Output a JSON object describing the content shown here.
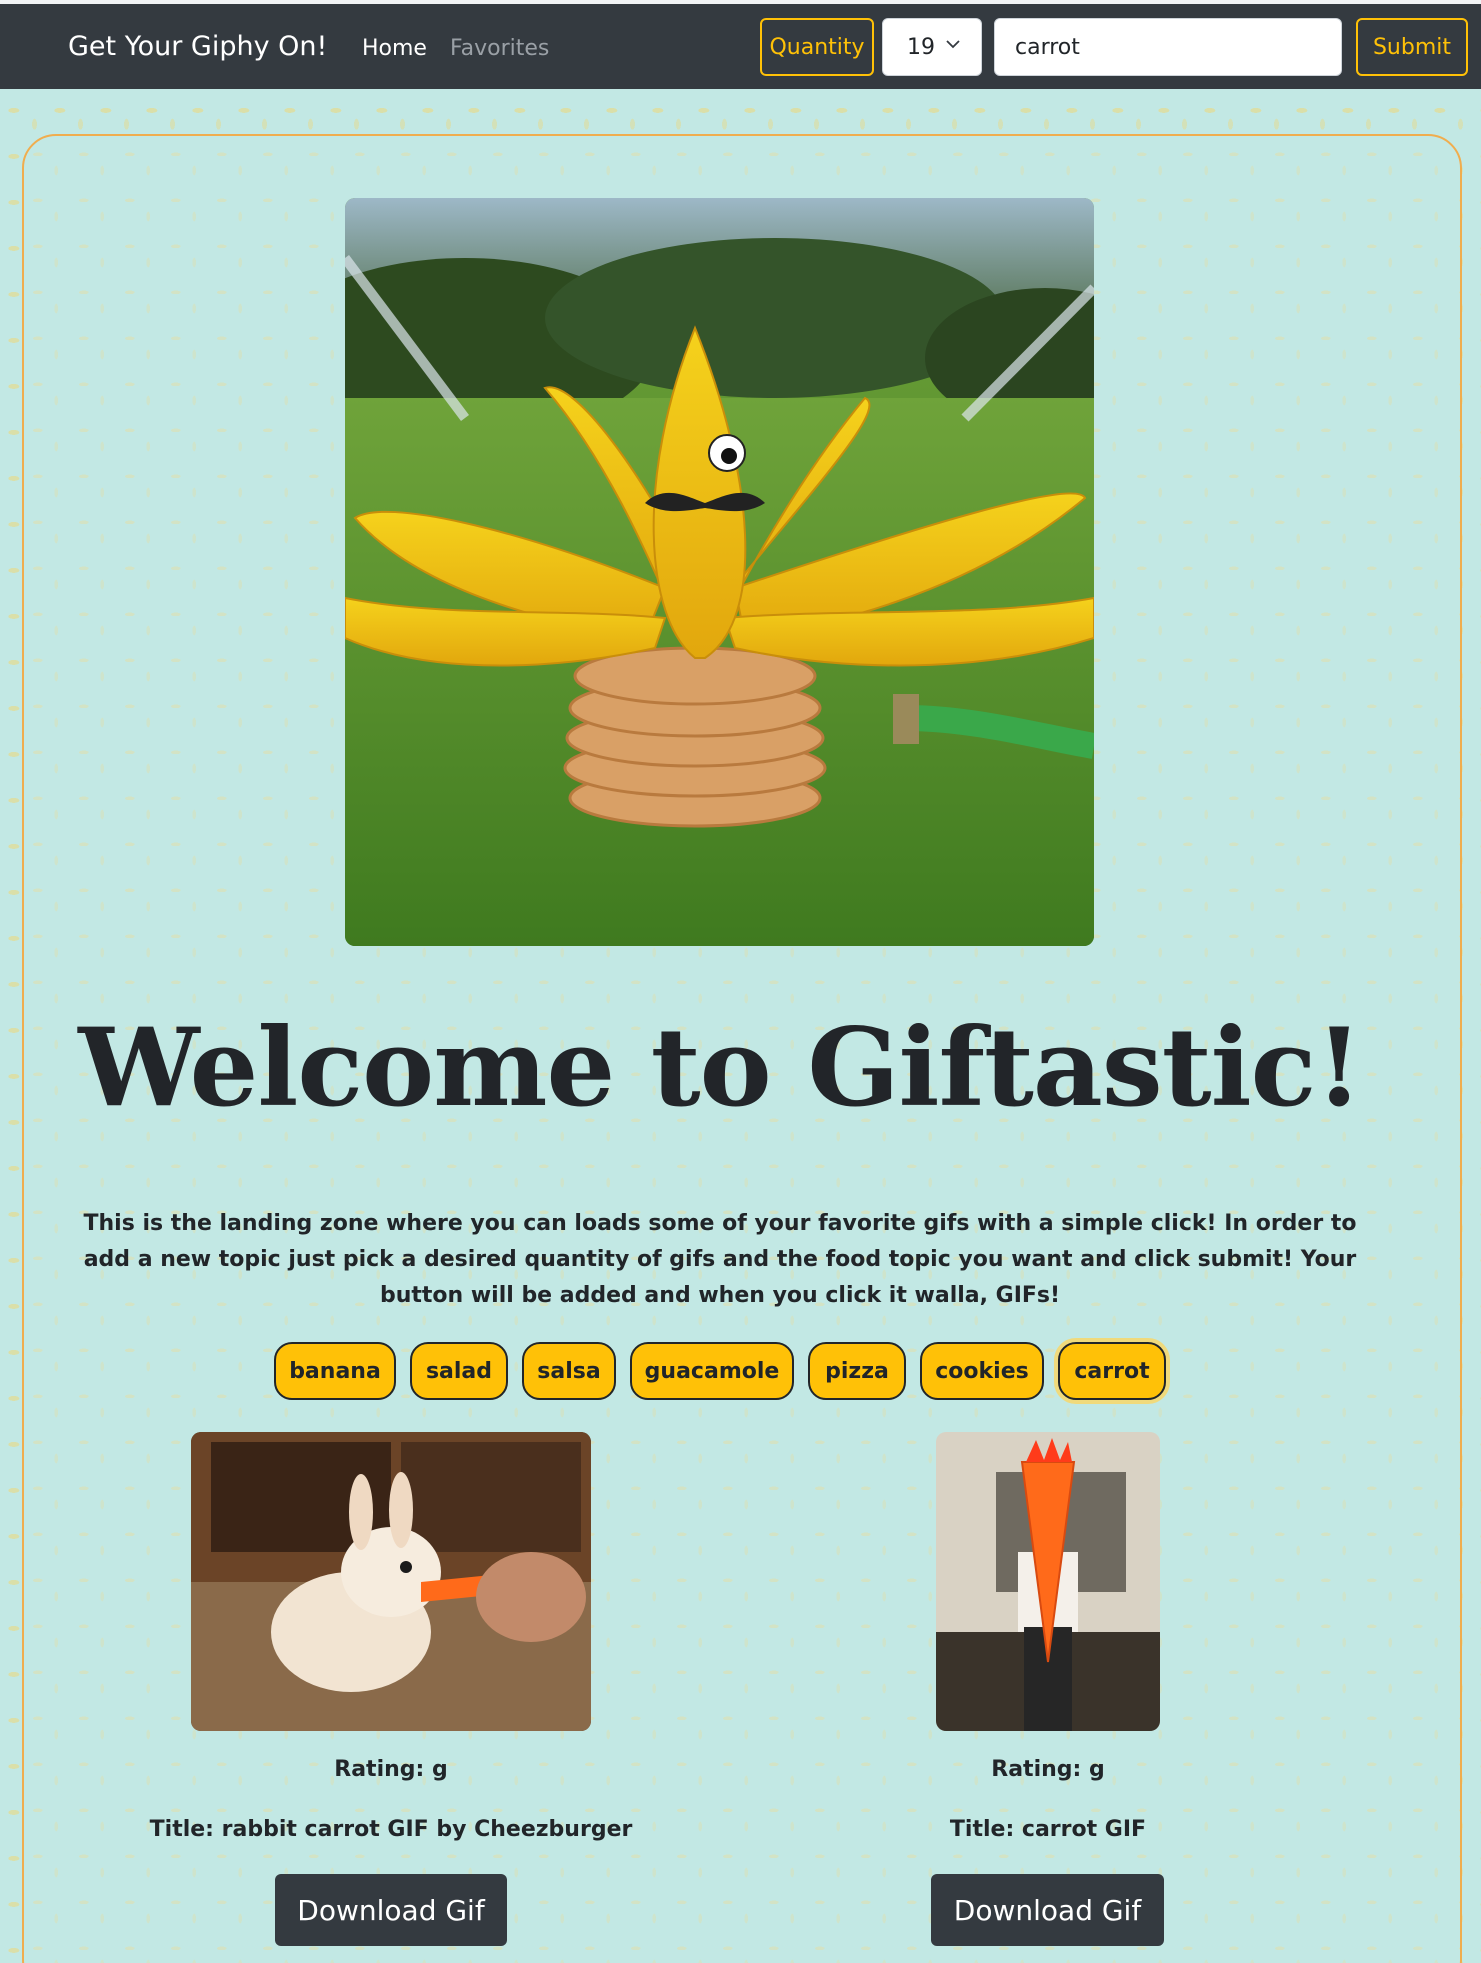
{
  "navbar": {
    "brand": "Get Your Giphy On!",
    "links": [
      {
        "label": "Home",
        "active": true
      },
      {
        "label": "Favorites",
        "active": false
      }
    ],
    "quantity_label": "Quantity",
    "quantity_value": "19",
    "search_value": "carrot",
    "submit_label": "Submit"
  },
  "hero": {
    "image": "banana-sprinkler-image"
  },
  "main": {
    "headline": "Welcome to Giftastic!",
    "intro": "This is the landing zone where you can loads some of your favorite gifs with a simple click! In order to add a new topic just pick a desired quantity of gifs and the food topic you want and click submit! Your button will be added and when you click it walla, GIFs!"
  },
  "topics": [
    "banana",
    "salad",
    "salsa",
    "guacamole",
    "pizza",
    "cookies",
    "carrot"
  ],
  "active_topic": "carrot",
  "gifs": [
    {
      "rating": "Rating: g",
      "title": "Title: rabbit carrot GIF by Cheezburger",
      "download_label": "Download Gif",
      "image": "rabbit-carrot-image"
    },
    {
      "rating": "Rating: g",
      "title": "Title: carrot GIF",
      "download_label": "Download Gif",
      "image": "carrot-costume-image"
    }
  ],
  "colors": {
    "navbar": "#343a40",
    "accent": "#ffc107",
    "background": "#c2e8e4",
    "card_border": "#f0ad4e"
  }
}
